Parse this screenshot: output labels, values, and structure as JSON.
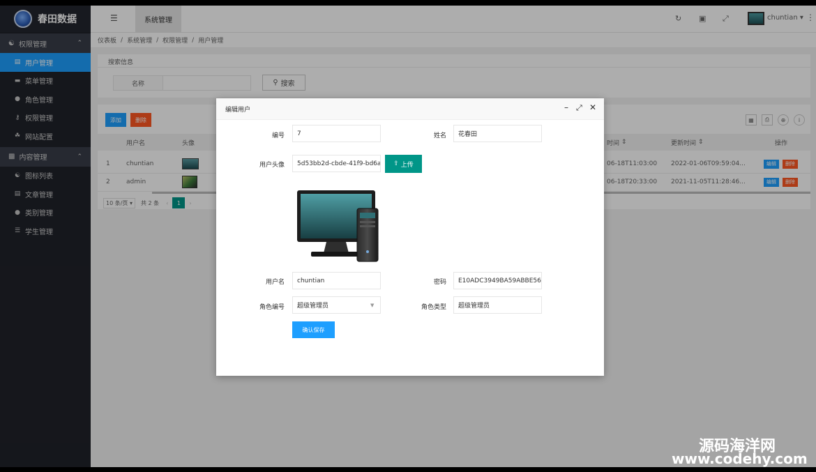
{
  "brand": {
    "name": "春田数据"
  },
  "sidebar": {
    "groups": [
      {
        "label": "权限管理",
        "items": [
          {
            "label": "用户管理",
            "active": true
          },
          {
            "label": "菜单管理"
          },
          {
            "label": "角色管理"
          },
          {
            "label": "权限管理"
          },
          {
            "label": "网站配置"
          }
        ]
      },
      {
        "label": "内容管理",
        "items": [
          {
            "label": "图标列表"
          },
          {
            "label": "文章管理"
          },
          {
            "label": "类别管理"
          },
          {
            "label": "学生管理"
          }
        ]
      }
    ]
  },
  "header": {
    "tab": "系统管理",
    "username": "chuntian"
  },
  "breadcrumb": [
    "仪表板",
    "系统管理",
    "权限管理",
    "用户管理"
  ],
  "search": {
    "title": "搜索信息",
    "label": "名称",
    "button": "搜索"
  },
  "table": {
    "add_label": "添加",
    "delete_label": "删除",
    "headers": {
      "username": "用户名",
      "avatar": "头像",
      "create_time": "时间",
      "update_time": "更新时间",
      "actions": "操作"
    },
    "rows": [
      {
        "idx": "1",
        "username": "chuntian",
        "create_time": "06-18T11:03:00",
        "update_time": "2022-01-06T09:59:04..."
      },
      {
        "idx": "2",
        "username": "admin",
        "create_time": "06-18T20:33:00",
        "update_time": "2021-11-05T11:28:46..."
      }
    ],
    "row_edit": "编辑",
    "row_delete": "删除",
    "page_size": "10 条/页",
    "total": "共 2 条",
    "page": "1"
  },
  "modal": {
    "title": "编辑用户",
    "fields": {
      "id": {
        "label": "编号",
        "value": "7"
      },
      "name": {
        "label": "姓名",
        "value": "花春田"
      },
      "avatar": {
        "label": "用户头像",
        "value": "5d53bb2d-cbde-41f9-bd6a-0"
      },
      "username": {
        "label": "用户名",
        "value": "chuntian"
      },
      "password": {
        "label": "密码",
        "value": "E10ADC3949BA59ABBE56E"
      },
      "role_id": {
        "label": "角色编号",
        "value": "超级管理员"
      },
      "role_type": {
        "label": "角色类型",
        "value": "超级管理员"
      }
    },
    "upload_label": "上传",
    "save_label": "确认保存"
  },
  "watermark": {
    "line1": "源码海洋网",
    "line2": "www.codehy.com"
  }
}
